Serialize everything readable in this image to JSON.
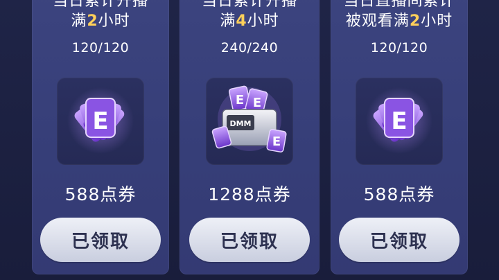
{
  "cards": [
    {
      "title_line1": "当日累计开播",
      "title_prefix": "满",
      "title_highlight": "2",
      "title_suffix": "小时",
      "progress": "120/120",
      "reward_icon": "purple-ticket-cards-icon",
      "amount": "588点券",
      "button_label": "已领取"
    },
    {
      "title_line1": "当日累计开播",
      "title_prefix": "满",
      "title_highlight": "4",
      "title_suffix": "小时",
      "progress": "240/240",
      "reward_icon": "ticket-box-icon",
      "amount": "1288点券",
      "button_label": "已领取"
    },
    {
      "title_line1": "当日直播间累计",
      "title_prefix": "被观看满",
      "title_highlight": "2",
      "title_suffix": "小时",
      "progress": "120/120",
      "reward_icon": "purple-ticket-cards-icon",
      "amount": "588点券",
      "button_label": "已领取"
    }
  ],
  "colors": {
    "highlight": "#ffd05a",
    "card_bg": "#3a427c",
    "button_bg": "#dfe2ee"
  }
}
